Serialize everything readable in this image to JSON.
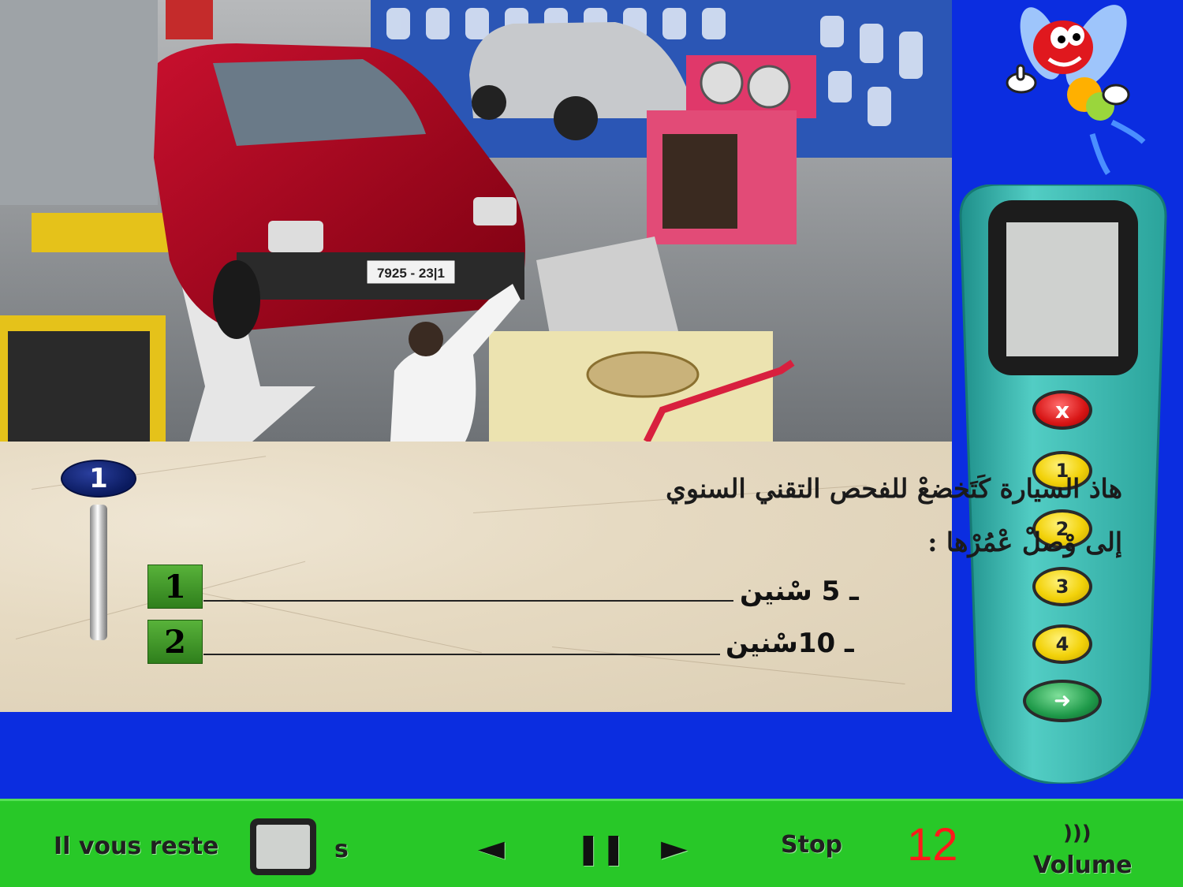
{
  "question": {
    "number": "1",
    "line1": "هاذ السيارة كَتَخضعْ  للفحص التقني السنوي",
    "line2": "إلى وْصلْ عْمُرْها :"
  },
  "answers": [
    {
      "key": "1",
      "text": "ـ 5 سْنين"
    },
    {
      "key": "2",
      "text": "ـ 10سْنين"
    }
  ],
  "photo": {
    "plate": "7925 - 23|1"
  },
  "remote": {
    "buttons": [
      {
        "label": "x",
        "icon": "cancel-icon"
      },
      {
        "label": "1"
      },
      {
        "label": "2"
      },
      {
        "label": "3"
      },
      {
        "label": "4"
      },
      {
        "label": "➜",
        "icon": "arrow-right-icon"
      }
    ]
  },
  "status_bar": {
    "remaining_label": "Il vous reste",
    "seconds_unit": "s",
    "prev_icon": "◄",
    "pause_icon": "❚❚",
    "next_icon": "►",
    "stop_label": "Stop",
    "counter": "12",
    "volume_label": "Volume",
    "volume_icon": ")))"
  },
  "colors": {
    "background": "#0b2de0",
    "status_bar": "#28c828",
    "counter": "#ff1a1a",
    "remote_body": "#3fb8b0"
  }
}
